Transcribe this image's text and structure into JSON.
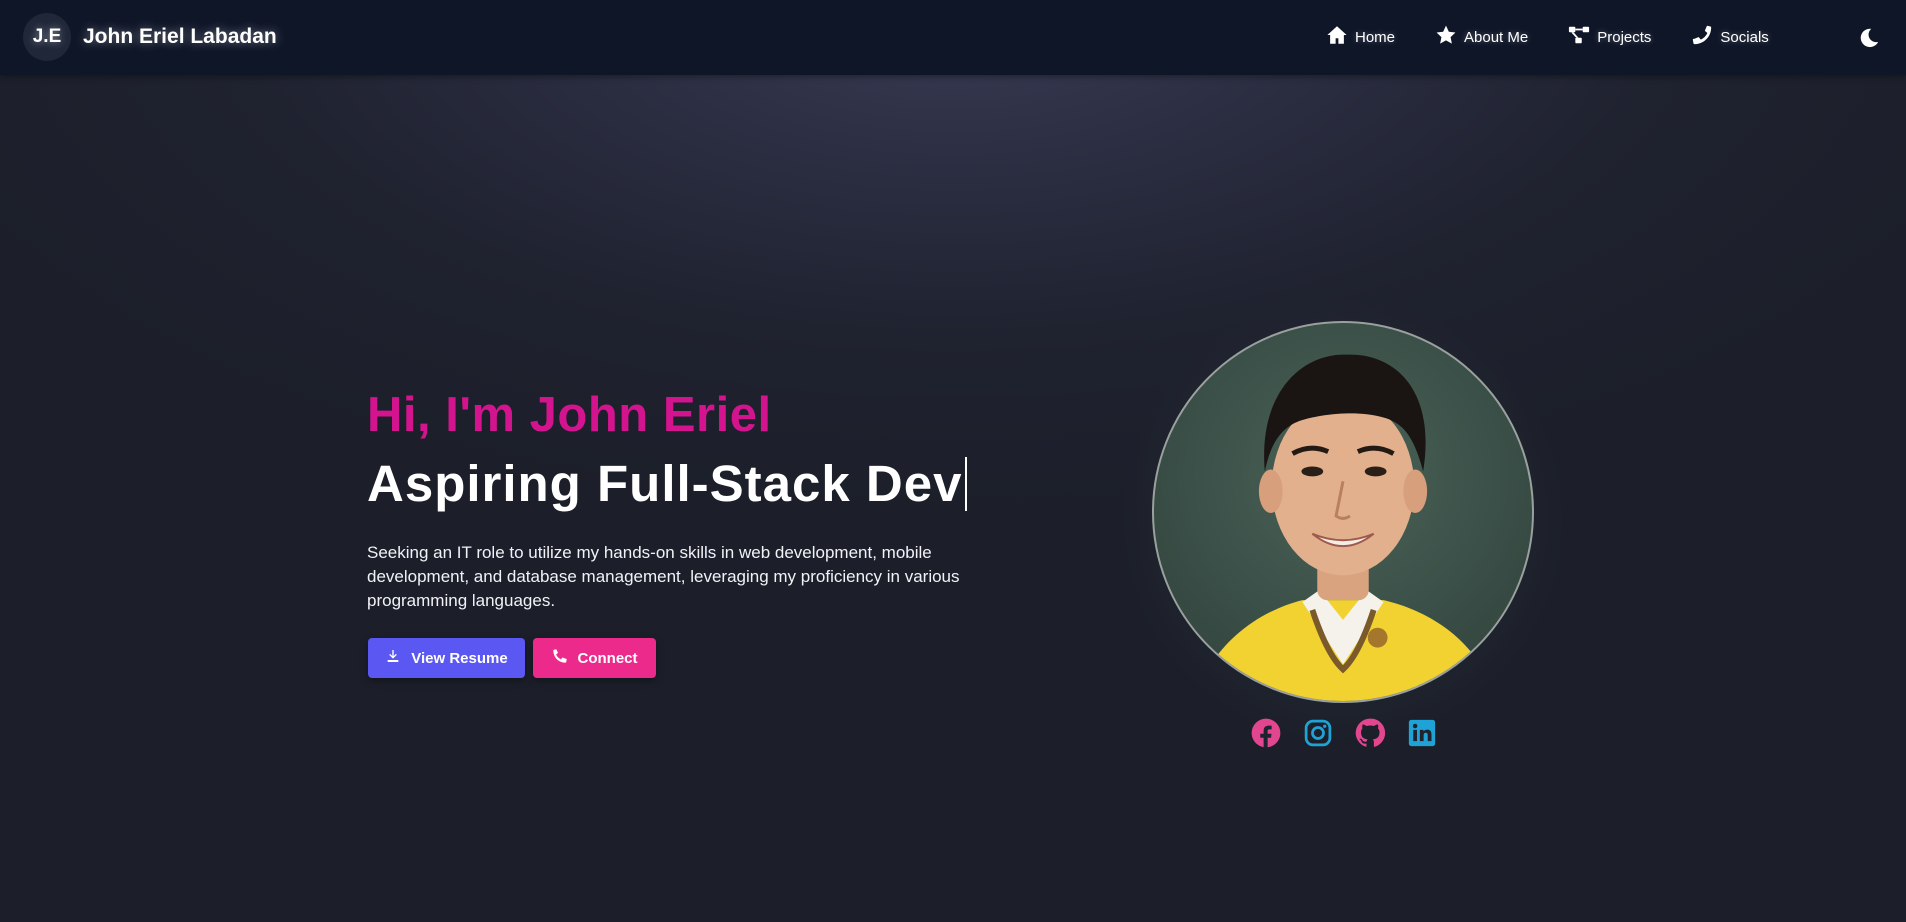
{
  "brand": {
    "mark": "J.E",
    "name": "John Eriel Labadan"
  },
  "nav": {
    "items": [
      {
        "label": "Home",
        "icon": "home-icon"
      },
      {
        "label": "About Me",
        "icon": "star-icon"
      },
      {
        "label": "Projects",
        "icon": "project-nodes-icon"
      },
      {
        "label": "Socials",
        "icon": "phone-icon"
      }
    ],
    "theme_toggle_icon": "moon-icon"
  },
  "hero": {
    "greeting": "Hi, I'm John Eriel",
    "role": "Aspiring Full-Stack Dev",
    "description": "Seeking an IT role to utilize my hands-on skills in web development, mobile development, and database management, leveraging my proficiency in various programming languages.",
    "buttons": {
      "resume_label": "View Resume",
      "resume_icon": "download-icon",
      "connect_label": "Connect",
      "connect_icon": "phone-icon"
    }
  },
  "profile": {
    "photo_alt": "profile-photo"
  },
  "socials": [
    {
      "name": "facebook-icon",
      "color": "#e2468f"
    },
    {
      "name": "instagram-icon",
      "color": "#1fa3d6"
    },
    {
      "name": "github-icon",
      "color": "#e2468f"
    },
    {
      "name": "linkedin-icon",
      "color": "#1fa3d6"
    }
  ],
  "colors": {
    "navbar": "#0f1628",
    "greeting": "#d4148e",
    "resume_button": "#5b57f2",
    "connect_button": "#ec2a8c",
    "social_pink": "#e2468f",
    "social_blue": "#1fa3d6"
  }
}
